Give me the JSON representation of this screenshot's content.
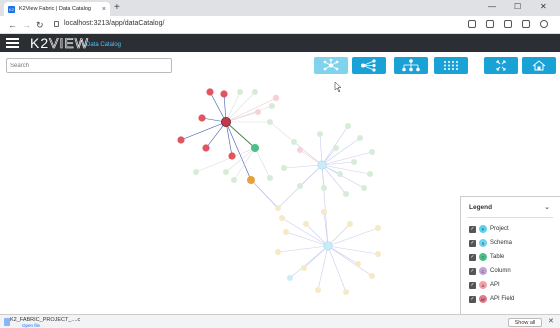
{
  "browser": {
    "tab_title": "K2View Fabric | Data Catalog",
    "tab_favicon": "K2",
    "new_tab": "+",
    "tab_close": "×",
    "url": "localhost:3213/app/dataCatalog/",
    "window_controls": {
      "minimize": "—",
      "maximize": "☐",
      "close": "✕"
    },
    "nav": {
      "back": "←",
      "forward": "→",
      "reload": "↻"
    }
  },
  "app": {
    "logo_k2": "K2",
    "logo_view": "VIEW",
    "subtitle": "Data Catalog"
  },
  "toolbar": {
    "search_placeholder": "Search",
    "buttons": [
      "force-layout-icon",
      "hierarchy-right-icon",
      "hierarchy-down-icon",
      "grid-layout-icon",
      "fit-screen-icon",
      "home-icon"
    ],
    "active_button": "force-layout-icon",
    "accent": "#1aa1d6",
    "active_color": "#7fd3ec"
  },
  "legend": {
    "title": "Legend",
    "chevron": "⌄",
    "items": [
      {
        "label": "Project",
        "color": "#5ad3f0",
        "glyph": "P"
      },
      {
        "label": "Schema",
        "color": "#6fd4f2",
        "glyph": "S"
      },
      {
        "label": "Table",
        "color": "#4bbf8a",
        "glyph": "T"
      },
      {
        "label": "Column",
        "color": "#c2a3d9",
        "glyph": "C"
      },
      {
        "label": "API",
        "color": "#f3a0a8",
        "glyph": "A"
      },
      {
        "label": "API Field",
        "color": "#e57a8a",
        "glyph": "AF"
      }
    ]
  },
  "download": {
    "file": "K2_FABRIC_PROJECT_....c",
    "open": "Open file",
    "show_all": "Show all",
    "close": "✕"
  },
  "graph": {
    "node_colors": {
      "api": "#e05560",
      "selected": "#c0394b",
      "table": "#4bbf8a",
      "column_orange": "#e8a13a",
      "faded_green": "#d6ecd9",
      "faded_cyan": "#c9ecf7",
      "faded_yellow": "#f6e9c6",
      "faded_pink": "#f6d2d6"
    }
  }
}
